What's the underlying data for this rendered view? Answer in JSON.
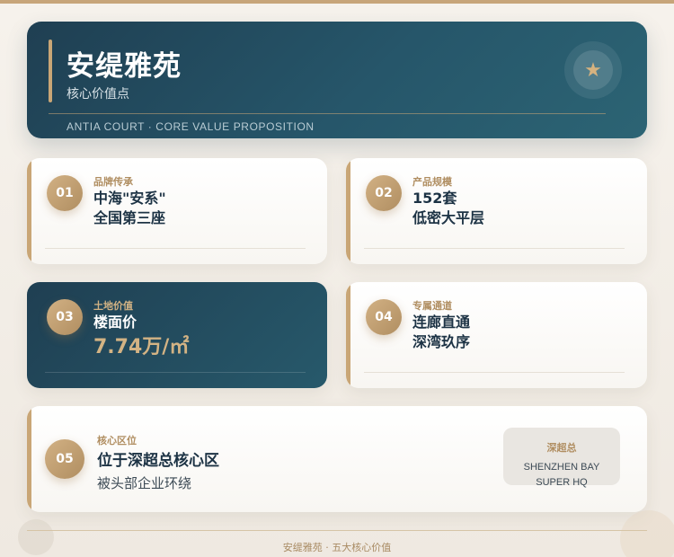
{
  "hero": {
    "title": "安缇雅苑",
    "subtitle": "核心价值点",
    "en_title": "ANTIA COURT · CORE VALUE PROPOSITION",
    "icon": "star-icon"
  },
  "cards": [
    {
      "num": "01",
      "label": "品牌传承",
      "line1": "中海\"安系\"",
      "line2": "全国第三座"
    },
    {
      "num": "02",
      "label": "产品规模",
      "line1": "152套",
      "line2": "低密大平层"
    },
    {
      "num": "03",
      "label": "土地价值",
      "line1": "楼面价",
      "line2": "7.74万/㎡"
    },
    {
      "num": "04",
      "label": "专属通道",
      "line1": "连廊直通",
      "line2": "深湾玖序"
    }
  ],
  "wide": {
    "num": "05",
    "label": "核心区位",
    "value": "位于深超总核心区",
    "sub": "被头部企业环绕",
    "badge_title": "深超总",
    "badge_text": "SHENZHEN BAY SUPER HQ"
  },
  "footer": "安缇雅苑 · 五大核心价值",
  "colors": {
    "accent_gold": "#c9a676",
    "navy": "#1f3f52",
    "teal": "#2c6474"
  }
}
